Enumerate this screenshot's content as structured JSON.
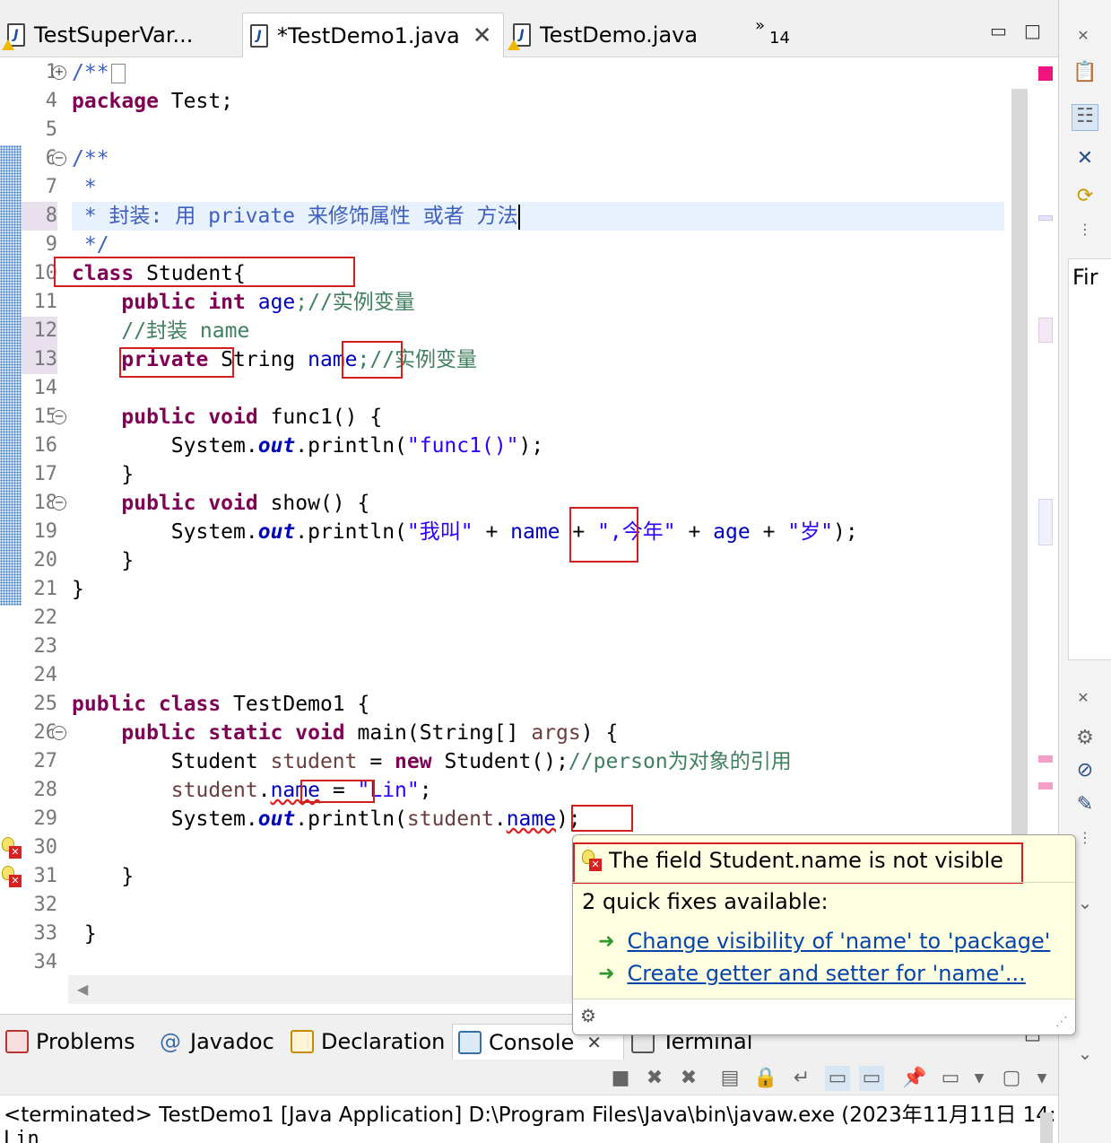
{
  "editor_tabs": [
    {
      "label": "TestSuperVar...",
      "active": false
    },
    {
      "label": "*TestDemo1.java",
      "active": true
    },
    {
      "label": "TestDemo.java",
      "active": false
    }
  ],
  "overflow": {
    "chevron": "»",
    "count": "14"
  },
  "line_numbers": [
    "1",
    "4",
    "5",
    "6",
    "7",
    "8",
    "9",
    "10",
    "11",
    "12",
    "13",
    "14",
    "15",
    "16",
    "17",
    "18",
    "19",
    "20",
    "21",
    "22",
    "23",
    "24",
    "25",
    "26",
    "27",
    "28",
    "29",
    "30",
    "31",
    "32",
    "33",
    "34"
  ],
  "code": {
    "l1": "/**",
    "l4_kw": "package",
    "l4_rest": " Test;",
    "l6": "/**",
    "l7": " *",
    "l8": " * 封装: 用 private 来修饰属性 或者 方法",
    "l9": " */",
    "l10_kw": "class",
    "l10_rest": " Student{",
    "l11_kw": "    public int",
    "l11_fld": " age",
    "l11_cm": ";//实例变量",
    "l12_cm": "    //封装 name",
    "l13_kw": "    private",
    "l13_type": " String ",
    "l13_fld": "name",
    "l13_cm": ";//实例变量",
    "l15_kw": "    public void",
    "l15_rest": " func1() {",
    "l16_pre": "        System.",
    "l16_out": "out",
    "l16_mid": ".println(",
    "l16_str": "\"func1()\"",
    "l16_end": ");",
    "l17": "    }",
    "l18_kw": "    public void",
    "l18_rest": " show() {",
    "l19_pre": "        System.",
    "l19_out": "out",
    "l19_mid": ".println(",
    "l19_s1": "\"我叫\"",
    "l19_p1": " + ",
    "l19_f1": "name",
    "l19_p2": " + ",
    "l19_s2": "\",今年\"",
    "l19_p3": " + ",
    "l19_f2": "age",
    "l19_p4": " + ",
    "l19_s3": "\"岁\"",
    "l19_end": ");",
    "l20": "    }",
    "l21": "}",
    "l25_kw": "public class",
    "l25_rest": " TestDemo1 {",
    "l26_kw": "    public static void",
    "l26_mid": " main(String[] ",
    "l26_arg": "args",
    "l26_end": ") {",
    "l27_pre": "        Student ",
    "l27_loc": "student",
    "l27_mid": " = ",
    "l27_kw": "new",
    "l27_rest": " Student();",
    "l27_cm": "//person为对象的引用",
    "l28_loc": "        student",
    "l28_dot": ".",
    "l28_fld": "name",
    "l28_mid": " = ",
    "l28_str": "\"Lin\"",
    "l28_end": ";",
    "l29_pre": "        System.",
    "l29_out": "out",
    "l29_mid": ".println(",
    "l29_loc": "student",
    "l29_dot": ".",
    "l29_fld": "name",
    "l29_end": ");",
    "l31": "    }",
    "l33": " }"
  },
  "quickfix": {
    "message": "The field Student.name is not visible",
    "count_label": "2 quick fixes available:",
    "fixes": [
      "Change visibility of 'name' to 'package'",
      "Create getter and setter for 'name'..."
    ]
  },
  "bottom_tabs": [
    {
      "label": "Problems"
    },
    {
      "label": "Javadoc",
      "prefix": "@"
    },
    {
      "label": "Declaration"
    },
    {
      "label": "Console",
      "active": true
    },
    {
      "label": "Terminal"
    }
  ],
  "console": {
    "header": "<terminated> TestDemo1 [Java Application] D:\\Program Files\\Java\\bin\\javaw.exe  (2023年11月11日 14:",
    "output": "Lin"
  },
  "right_panel": {
    "partial_label": "Fir"
  },
  "colors": {
    "keyword": "#7f0055",
    "comment": "#3f7f5f",
    "javadoc": "#3f5fbf",
    "string": "#2a00ff",
    "field": "#0000c0",
    "error": "#d41f1f",
    "link": "#0645ad"
  }
}
